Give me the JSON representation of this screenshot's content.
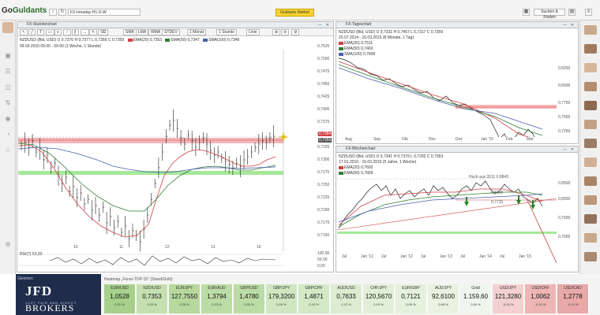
{
  "app": {
    "logo_text_1": "Go",
    "logo_text_2": "Guldants",
    "url": "FX-Intraday-H1-D-W",
    "toolbar_button": "Guidants Market",
    "search_label": "Suchen & Finden"
  },
  "chart_main": {
    "panel_title": "FX-Stundenchart",
    "toolbar": [
      "SMA",
      "LMA",
      "WMA",
      "STDEV",
      "1 Monat",
      "1 Stunde",
      "Linie"
    ],
    "legend": {
      "instrument": "NZDUSD (Bid, USD)",
      "ohlc": "O 0,7370  H 0,7377  L 0,7359  C 0,7359",
      "ema20": "EMA(20) 0,7353",
      "ema50": "EMA(50) 0,7347",
      "sma100": "SMA(100) 0,7349"
    },
    "date_range": "09.03.2015 05:00 - 09:00 (1 Woche, 1 Stunde)",
    "y_ticks": [
      "0,7525",
      "0,7500",
      "0,7475",
      "0,7450",
      "0,7425",
      "0,7400",
      "0,7375",
      "0,7350",
      "0,7325",
      "0,7300",
      "0,7275",
      "0,7250",
      "0,7225",
      "0,7200",
      "0,7175",
      "0,7150"
    ],
    "x_ticks": [
      "10",
      "11",
      "12",
      "13",
      "16"
    ],
    "rsi_label": "RSI(7) 52,30",
    "rsi_ticks": [
      "100,00",
      "50,00",
      "0,00"
    ],
    "price_tags": [
      "0,7384",
      "0,7359",
      "0,7358",
      "0,7353"
    ]
  },
  "chart_daily": {
    "panel_title": "FX-Tageschart",
    "legend": {
      "ohlc": "NZDUSD (Bid, USD)  O 0,7331  H 0,7457  L 0,7317  C 0,7359",
      "range": "20.07.2014 - 16.03.2015 (8 Monate, 1 Tag)",
      "ema20": "EMA(20) 0,7511",
      "ema50": "EMA(50) 0,7463",
      "sma100": "SMA(100) 0,7609"
    },
    "y_ticks": [
      "0,8250",
      "0,8000",
      "0,7750",
      "0,7500",
      "0,7250"
    ],
    "x_ticks": [
      "Aug",
      "Sep",
      "Okt",
      "Nov",
      "Dez",
      "Jan '15",
      "Feb",
      "Mär"
    ]
  },
  "chart_weekly": {
    "panel_title": "FX-Wochenchart",
    "legend": {
      "ohlc": "NZDUSD (Bid, USD)  O 0,7341  H 0,7379  L 0,7292  C 0,7353",
      "range": "17.01.2010 - 16.03.2015 (5 Jahre, 1 Woche)",
      "ema20": "EMA(20) 0,7692",
      "ema50": "EMA(50) 0,7805"
    },
    "annotations": [
      "Hoch aus 2011 0,8843",
      "0,7715",
      "0,8106"
    ],
    "y_ticks": [
      "0,8500",
      "0,8000",
      "0,7500",
      "0,7000"
    ],
    "x_ticks": [
      "Jul",
      "Jan '11",
      "Jul",
      "Jan '12",
      "Jul",
      "Jan '13",
      "Jul",
      "Jan '14",
      "Jul",
      "Jan '15"
    ]
  },
  "bottom": {
    "tab_label": "Gleichen",
    "jfd_text": "JFD",
    "brokers_text": "BROKERS",
    "tagline": "JUST FAIR AND DIRECT",
    "heatmap_title": "Heatmap „Forex-TOP-15\" (Stand/Gold)",
    "cells": [
      {
        "name": "EUR/USD",
        "value": "1,0528",
        "pct": "0,31 %",
        "color": "#a8d08d"
      },
      {
        "name": "NZD/USD",
        "value": "0,7353",
        "pct": "0,20 %",
        "color": "#c4e0b0"
      },
      {
        "name": "EUR/JPY",
        "value": "127,7550",
        "pct": "0,25 %",
        "color": "#b7d99e"
      },
      {
        "name": "EUR/AUD",
        "value": "1,3794",
        "pct": "0,23 %",
        "color": "#bcdca5"
      },
      {
        "name": "GBP/USD",
        "value": "1,4780",
        "pct": "0,23 %",
        "color": "#bcdca5"
      },
      {
        "name": "GBP/JPY",
        "value": "179,3200",
        "pct": "0,16 %",
        "color": "#d0e6c0"
      },
      {
        "name": "GBP/CHF",
        "value": "1,4871",
        "pct": "0,15 %",
        "color": "#d3e8c4"
      },
      {
        "name": "AUD/USD",
        "value": "0,7633",
        "pct": "0,12 %",
        "color": "#dbecd0"
      },
      {
        "name": "CHF/JPY",
        "value": "120,5670",
        "pct": "0,10 %",
        "color": "#e1efd8"
      },
      {
        "name": "EUR/GBP",
        "value": "0,7121",
        "pct": "0,09 %",
        "color": "#e4f1dc"
      },
      {
        "name": "AUD/JPY",
        "value": "92,6100",
        "pct": "0,08 %",
        "color": "#e8f3e2"
      },
      {
        "name": "Gold",
        "value": "1.159,60",
        "pct": "0,04 %",
        "color": "#eff6eb"
      },
      {
        "name": "USD/JPY",
        "value": "121,3280",
        "pct": "-0,04 %",
        "color": "#f5d0d0"
      },
      {
        "name": "USD/CHF",
        "value": "1,0062",
        "pct": "-0,10 %",
        "color": "#eeb5b5"
      },
      {
        "name": "USD/CAD",
        "value": "1,2778",
        "pct": "-0,12 %",
        "color": "#eaa9a9"
      }
    ]
  },
  "colors": {
    "resistance_zone": "#f4b8b8",
    "support_zone": "#a6e89a",
    "ema20": "#d04040",
    "ema50": "#2e7d32",
    "sma100": "#4a5fb0"
  }
}
